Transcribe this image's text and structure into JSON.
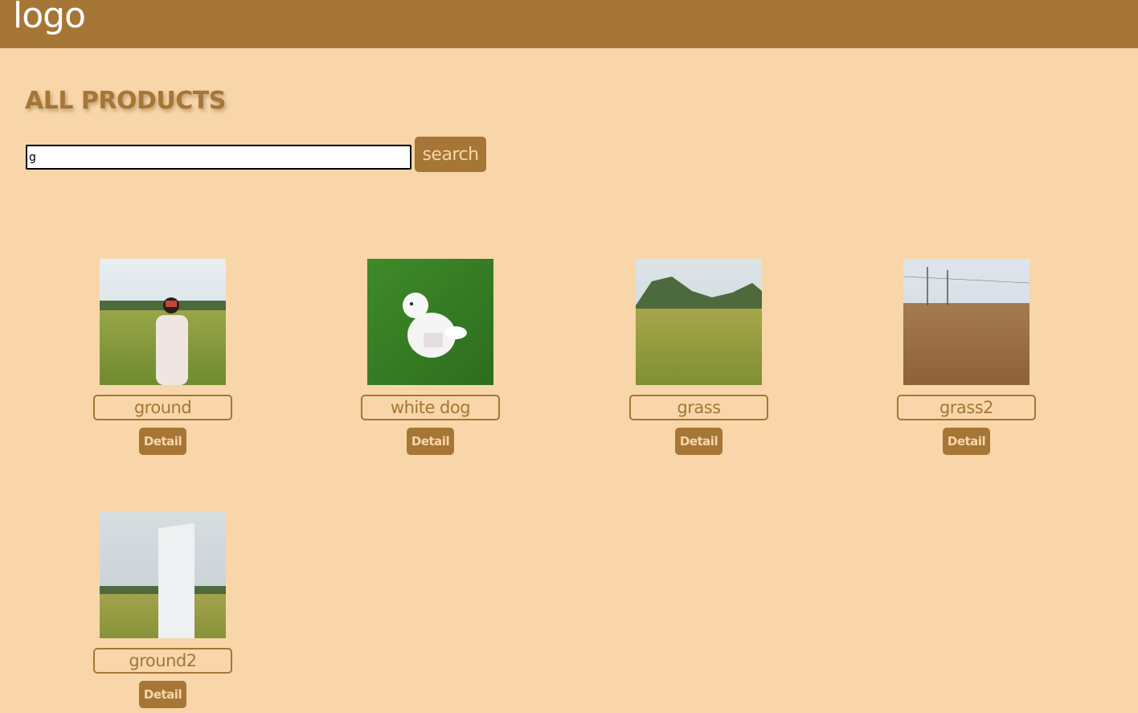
{
  "header": {
    "logo_text": "logo"
  },
  "main": {
    "title": "ALL PRODUCTS",
    "search": {
      "value": "g",
      "button_label": "search"
    }
  },
  "products": [
    {
      "name": "ground",
      "detail_label": "Detail",
      "image": "woman-in-field-photo"
    },
    {
      "name": "white dog",
      "detail_label": "Detail",
      "image": "white-dog-on-grass-photo"
    },
    {
      "name": "grass",
      "detail_label": "Detail",
      "image": "field-with-mountains-photo"
    },
    {
      "name": "grass2",
      "detail_label": "Detail",
      "image": "dry-reed-field-photo"
    },
    {
      "name": "ground2",
      "detail_label": "Detail",
      "image": "white-monolith-in-field-photo"
    }
  ],
  "colors": {
    "header": "#A67636",
    "background": "#F8D6A9",
    "accent": "#A67636"
  }
}
